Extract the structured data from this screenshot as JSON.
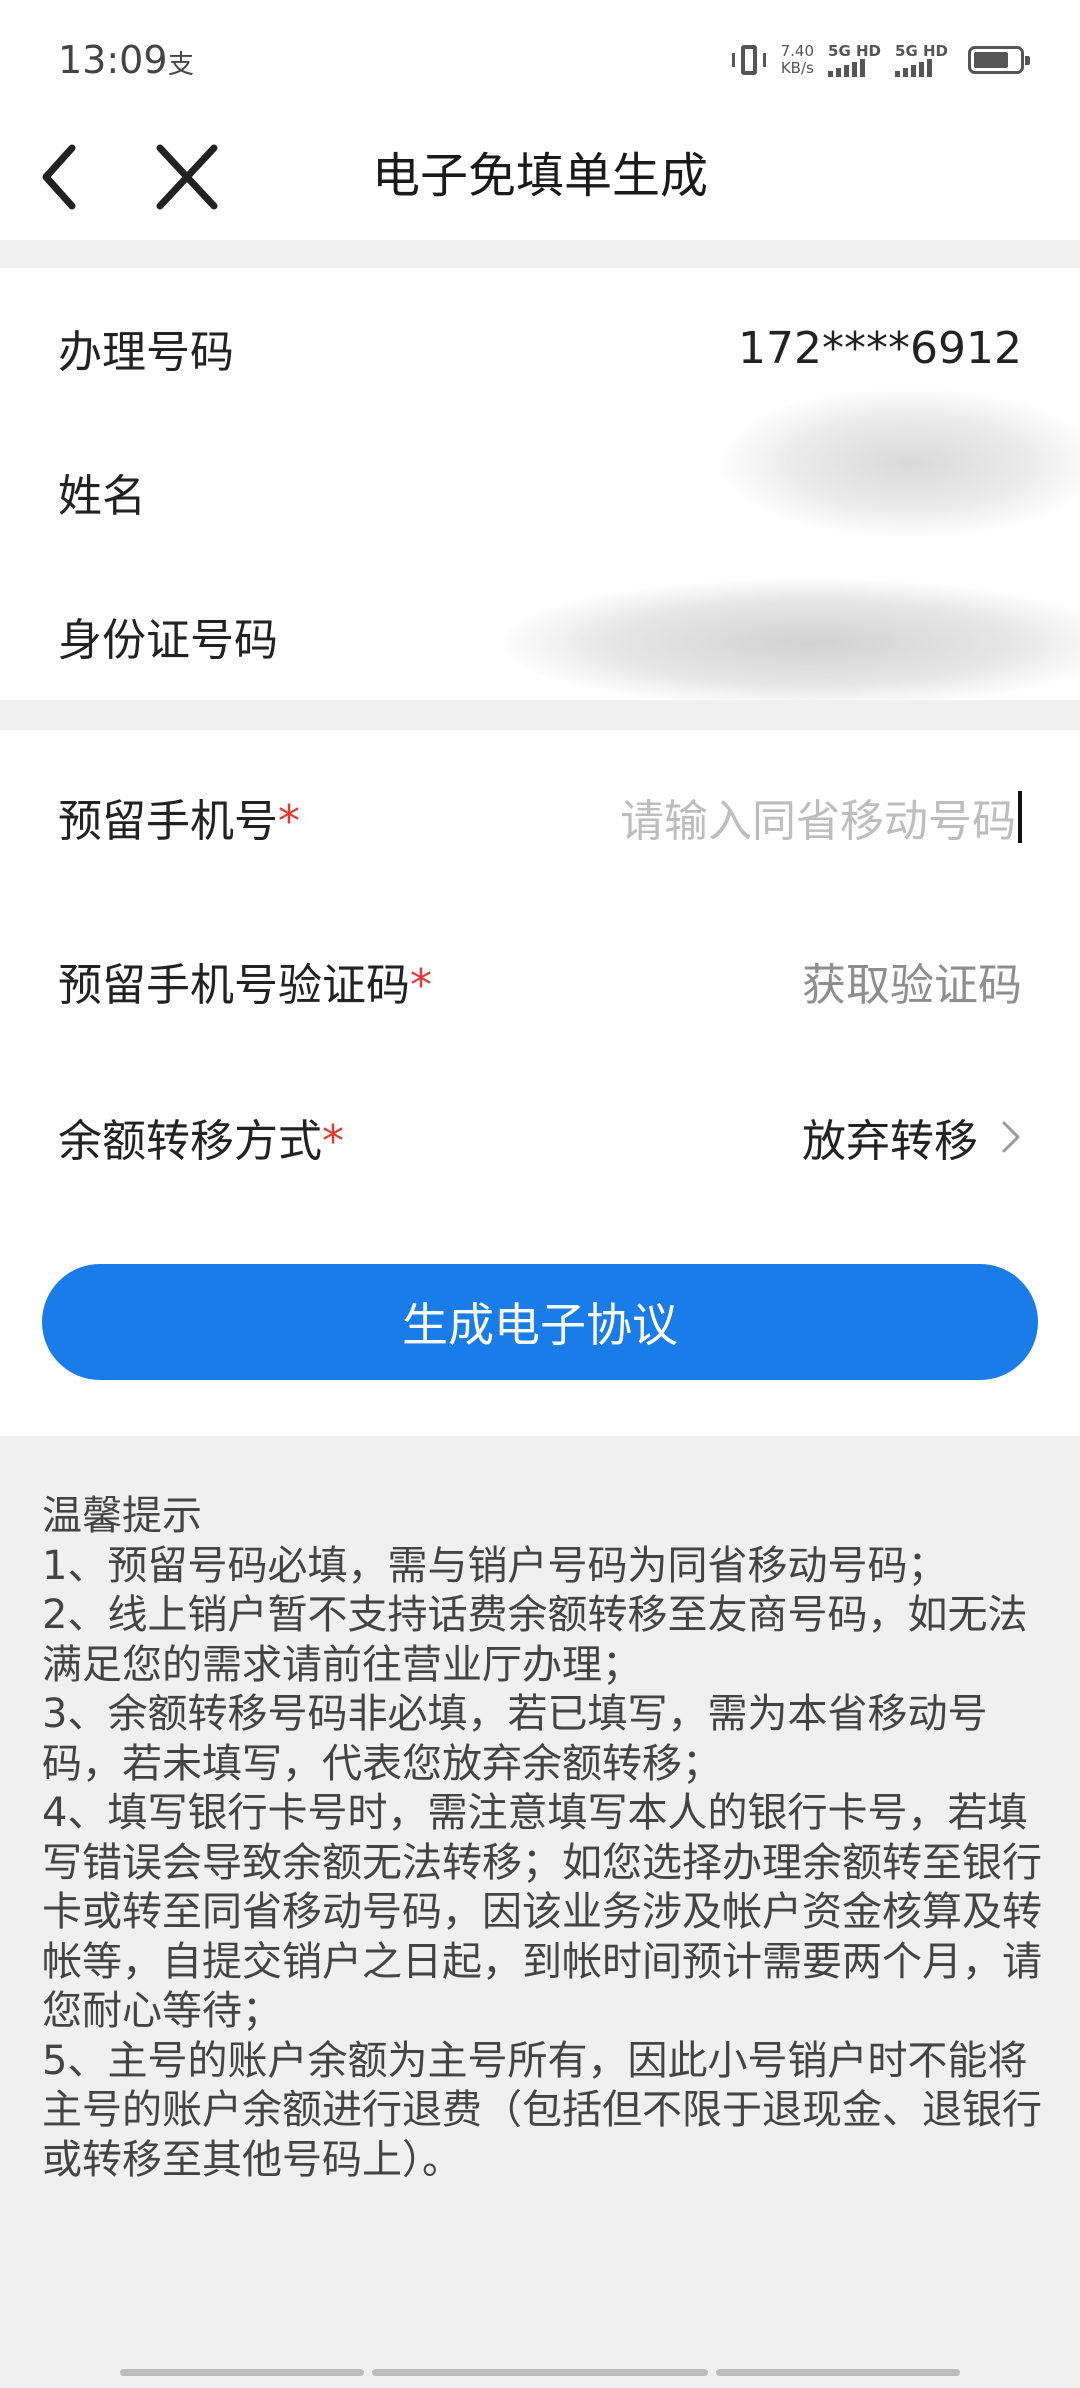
{
  "status_bar": {
    "time": "13:09",
    "app_indicator": "支",
    "net_speed_value": "7.40",
    "net_speed_unit": "KB/s",
    "sim1_label": "5G HD",
    "sim2_label": "5G HD"
  },
  "nav": {
    "title": "电子免填单生成",
    "back_icon": "chevron-left-icon",
    "close_icon": "close-icon"
  },
  "info": {
    "phone_label": "办理号码",
    "phone_value": "172****6912",
    "name_label": "姓名",
    "id_label": "身份证号码"
  },
  "form": {
    "required_mark": "*",
    "reserved_phone_label": "预留手机号",
    "reserved_phone_placeholder": "请输入同省移动号码",
    "verify_code_label": "预留手机号验证码",
    "verify_code_action": "获取验证码",
    "balance_transfer_label": "余额转移方式",
    "balance_transfer_value": "放弃转移",
    "submit_label": "生成电子协议"
  },
  "tips": {
    "title": "温馨提示",
    "items": [
      "1、预留号码必填，需与销户号码为同省移动号码；",
      "2、线上销户暂不支持话费余额转移至友商号码，如无法满足您的需求请前往营业厅办理；",
      "3、余额转移号码非必填，若已填写，需为本省移动号码，若未填写，代表您放弃余额转移；",
      "4、填写银行卡号时，需注意填写本人的银行卡号，若填写错误会导致余额无法转移；如您选择办理余额转至银行卡或转至同省移动号码，因该业务涉及帐户资金核算及转帐等，自提交销户之日起，到帐时间预计需要两个月，请您耐心等待；",
      "5、主号的账户余额为主号所有，因此小号销户时不能将主号的账户余额进行退费（包括但不限于退现金、退银行或转移至其他号码上）。"
    ]
  },
  "colors": {
    "primary": "#1a7ce8",
    "required": "#e53935",
    "background": "#f0f0f0"
  }
}
